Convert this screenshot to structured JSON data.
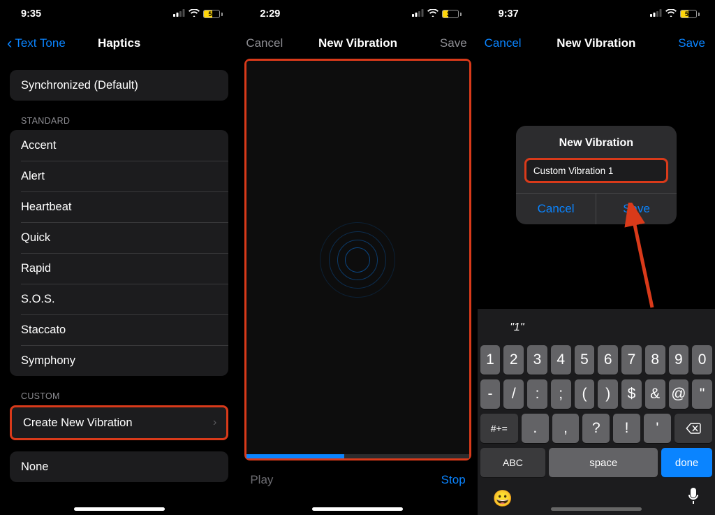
{
  "screen1": {
    "time": "9:35",
    "battery": "52",
    "back_label": "Text Tone",
    "title": "Haptics",
    "top_cell": "Synchronized (Default)",
    "standard_header": "STANDARD",
    "standard_items": [
      "Accent",
      "Alert",
      "Heartbeat",
      "Quick",
      "Rapid",
      "S.O.S.",
      "Staccato",
      "Symphony"
    ],
    "custom_header": "CUSTOM",
    "create_new_label": "Create New Vibration",
    "none_label": "None"
  },
  "screen2": {
    "time": "2:29",
    "battery": "39",
    "cancel_label": "Cancel",
    "title": "New Vibration",
    "save_label": "Save",
    "play_label": "Play",
    "stop_label": "Stop",
    "progress_percent": 44
  },
  "screen3": {
    "time": "9:37",
    "battery": "51",
    "cancel_label": "Cancel",
    "title": "New Vibration",
    "save_label": "Save",
    "alert_title": "New Vibration",
    "alert_input_value": "Custom Vibration 1",
    "alert_cancel": "Cancel",
    "alert_save": "Save",
    "prediction": "\"1\"",
    "key_rows": {
      "r1": [
        "1",
        "2",
        "3",
        "4",
        "5",
        "6",
        "7",
        "8",
        "9",
        "0"
      ],
      "r2": [
        "-",
        "/",
        ":",
        ";",
        "(",
        ")",
        "$",
        "&",
        "@",
        "\""
      ],
      "r3_shift": "#+=",
      "r3": [
        ".",
        ",",
        "?",
        "!",
        "'"
      ],
      "r3_backspace_icon": "backspace-icon",
      "bottom_abc": "ABC",
      "bottom_space": "space",
      "bottom_done": "done",
      "emoji_icon": "emoji-icon",
      "mic_icon": "mic-icon"
    }
  }
}
